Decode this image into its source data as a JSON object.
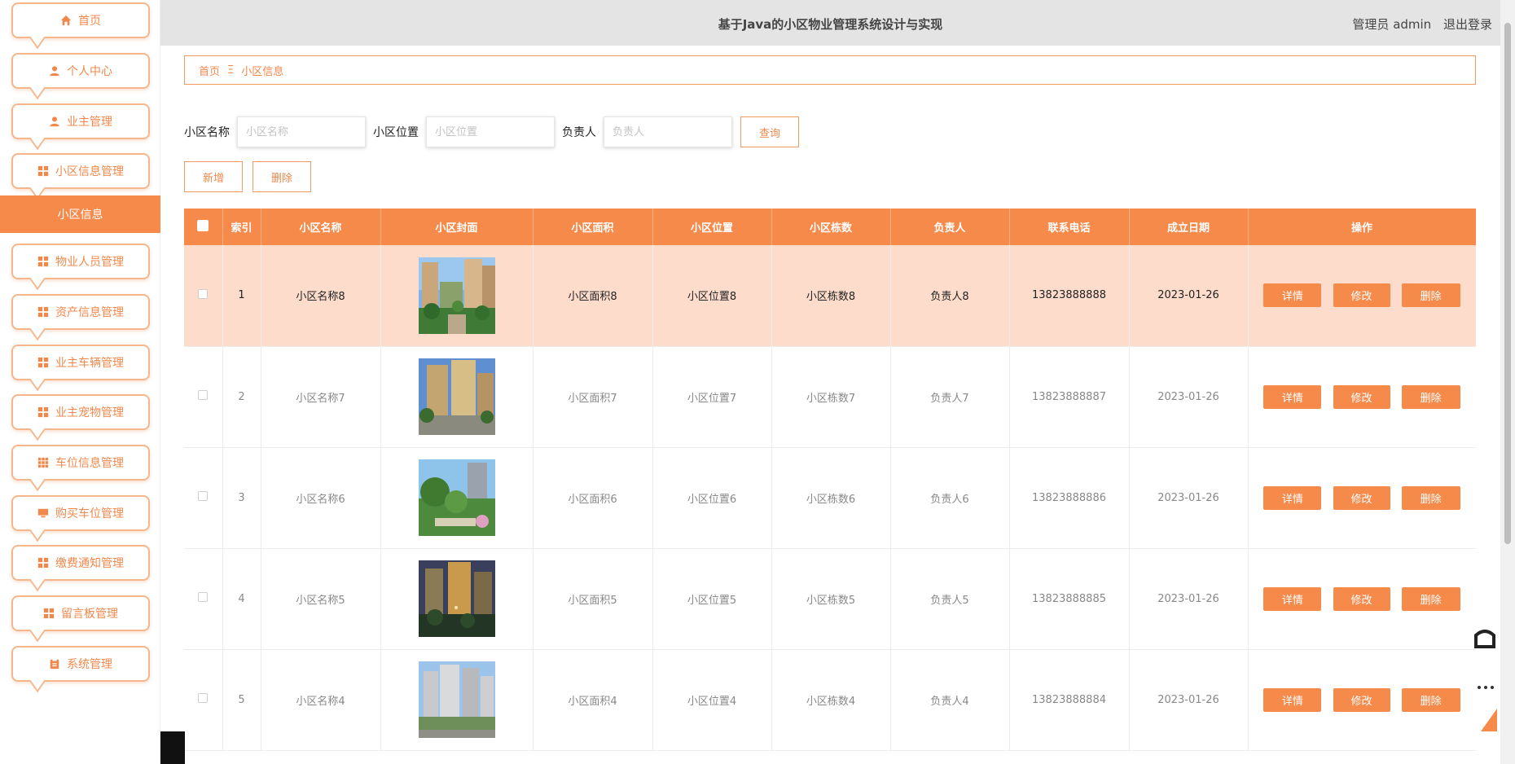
{
  "header": {
    "title": "基于Java的小区物业管理系统设计与实现",
    "user_label": "管理员 admin",
    "logout_label": "退出登录"
  },
  "sidebar": {
    "items": [
      {
        "label": "首页",
        "icon": "home-icon"
      },
      {
        "label": "个人中心",
        "icon": "user-icon"
      },
      {
        "label": "业主管理",
        "icon": "user-icon"
      },
      {
        "label": "小区信息管理",
        "icon": "grid-icon"
      },
      {
        "label": "物业人员管理",
        "icon": "grid-icon"
      },
      {
        "label": "资产信息管理",
        "icon": "grid-icon"
      },
      {
        "label": "业主车辆管理",
        "icon": "grid-icon"
      },
      {
        "label": "业主宠物管理",
        "icon": "grid-icon"
      },
      {
        "label": "车位信息管理",
        "icon": "apps-icon"
      },
      {
        "label": "购买车位管理",
        "icon": "monitor-icon"
      },
      {
        "label": "缴费通知管理",
        "icon": "grid-icon"
      },
      {
        "label": "留言板管理",
        "icon": "grid-icon"
      },
      {
        "label": "系统管理",
        "icon": "clipboard-icon"
      }
    ],
    "active_sub": "小区信息"
  },
  "breadcrumb": {
    "home": "首页",
    "separator": "Ξ",
    "current": "小区信息"
  },
  "search": {
    "name_label": "小区名称",
    "name_placeholder": "小区名称",
    "location_label": "小区位置",
    "location_placeholder": "小区位置",
    "manager_label": "负责人",
    "manager_placeholder": "负责人",
    "query_label": "查询"
  },
  "actions": {
    "add_label": "新增",
    "delete_label": "删除"
  },
  "table": {
    "columns": [
      "索引",
      "小区名称",
      "小区封面",
      "小区面积",
      "小区位置",
      "小区栋数",
      "负责人",
      "联系电话",
      "成立日期",
      "操作"
    ],
    "rows": [
      {
        "index": "1",
        "name": "小区名称8",
        "area": "小区面积8",
        "location": "小区位置8",
        "buildings": "小区栋数8",
        "manager": "负责人8",
        "phone": "13823888888",
        "date": "2023-01-26"
      },
      {
        "index": "2",
        "name": "小区名称7",
        "area": "小区面积7",
        "location": "小区位置7",
        "buildings": "小区栋数7",
        "manager": "负责人7",
        "phone": "13823888887",
        "date": "2023-01-26"
      },
      {
        "index": "3",
        "name": "小区名称6",
        "area": "小区面积6",
        "location": "小区位置6",
        "buildings": "小区栋数6",
        "manager": "负责人6",
        "phone": "13823888886",
        "date": "2023-01-26"
      },
      {
        "index": "4",
        "name": "小区名称5",
        "area": "小区面积5",
        "location": "小区位置5",
        "buildings": "小区栋数5",
        "manager": "负责人5",
        "phone": "13823888885",
        "date": "2023-01-26"
      },
      {
        "index": "5",
        "name": "小区名称4",
        "area": "小区面积4",
        "location": "小区位置4",
        "buildings": "小区栋数4",
        "manager": "负责人4",
        "phone": "13823888884",
        "date": "2023-01-26"
      }
    ],
    "op_detail": "详情",
    "op_edit": "修改",
    "op_delete": "删除"
  },
  "colors": {
    "accent": "#f58a4b",
    "row_highlight": "#fddccb",
    "header_bg": "#e5e4e4"
  }
}
